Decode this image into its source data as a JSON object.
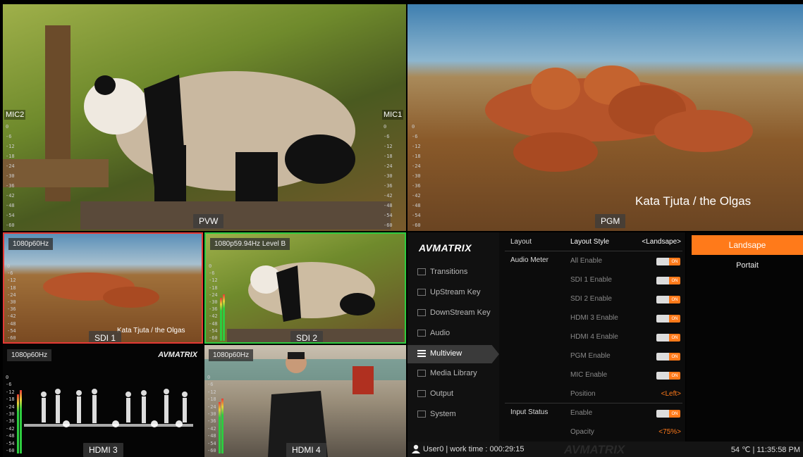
{
  "tiles": {
    "pvw": {
      "label": "PVW",
      "mic_left": "MIC2",
      "mic_right": "MIC1"
    },
    "pgm": {
      "label": "PGM",
      "caption": "Kata Tjuta / the Olgas"
    },
    "sdi1": {
      "label": "SDI 1",
      "format": "1080p60Hz",
      "caption": "Kata Tjuta / the Olgas"
    },
    "sdi2": {
      "label": "SDI 2",
      "format": "1080p59.94Hz  Level B"
    },
    "hdmi3": {
      "label": "HDMI 3",
      "format": "1080p60Hz",
      "watermark": "AVMATRIX"
    },
    "hdmi4": {
      "label": "HDMI 4",
      "format": "1080p60Hz"
    }
  },
  "meter_scale": [
    "0",
    "-6",
    "-12",
    "-18",
    "-24",
    "-30",
    "-36",
    "-42",
    "-48",
    "-54",
    "-60"
  ],
  "menu": {
    "logo": "AVMATRIX",
    "items": [
      {
        "label": "Transitions",
        "icon": "transitions-icon"
      },
      {
        "label": "UpStream Key",
        "icon": "upstream-key-icon"
      },
      {
        "label": "DownStream Key",
        "icon": "downstream-key-icon"
      },
      {
        "label": "Audio",
        "icon": "audio-icon"
      },
      {
        "label": "Multiview",
        "icon": "multiview-icon",
        "active": true
      },
      {
        "label": "Media Library",
        "icon": "media-library-icon"
      },
      {
        "label": "Output",
        "icon": "output-icon"
      },
      {
        "label": "System",
        "icon": "system-gear-icon"
      }
    ]
  },
  "settings": {
    "sections": {
      "layout": "Layout",
      "audio_meter": "Audio Meter",
      "input_status": "Input Status"
    },
    "rows": [
      {
        "label": "Layout Style",
        "value": "<Landsape>",
        "type": "select",
        "highlight": true
      },
      {
        "label": "All Enable",
        "value": "ON",
        "type": "toggle"
      },
      {
        "label": "SDI 1 Enable",
        "value": "ON",
        "type": "toggle"
      },
      {
        "label": "SDI 2 Enable",
        "value": "ON",
        "type": "toggle"
      },
      {
        "label": "HDMI 3 Enable",
        "value": "ON",
        "type": "toggle"
      },
      {
        "label": "HDMI 4 Enable",
        "value": "ON",
        "type": "toggle"
      },
      {
        "label": "PGM Enable",
        "value": "ON",
        "type": "toggle"
      },
      {
        "label": "MIC Enable",
        "value": "ON",
        "type": "toggle"
      },
      {
        "label": "Position",
        "value": "<Left>",
        "type": "select"
      },
      {
        "label": "Enable",
        "value": "ON",
        "type": "toggle"
      },
      {
        "label": "Opacity",
        "value": "<75%>",
        "type": "select"
      }
    ]
  },
  "options": {
    "selected": "Landsape",
    "other": "Portait"
  },
  "status": {
    "user": "User0 | work time : 000:29:15",
    "watermark": "AVMATRIX",
    "right": "54 ℃ | 11:35:58 PM"
  },
  "colors": {
    "accent": "#ff7a1a",
    "preview_border": "#2ecc40",
    "program_border": "#e53935"
  }
}
